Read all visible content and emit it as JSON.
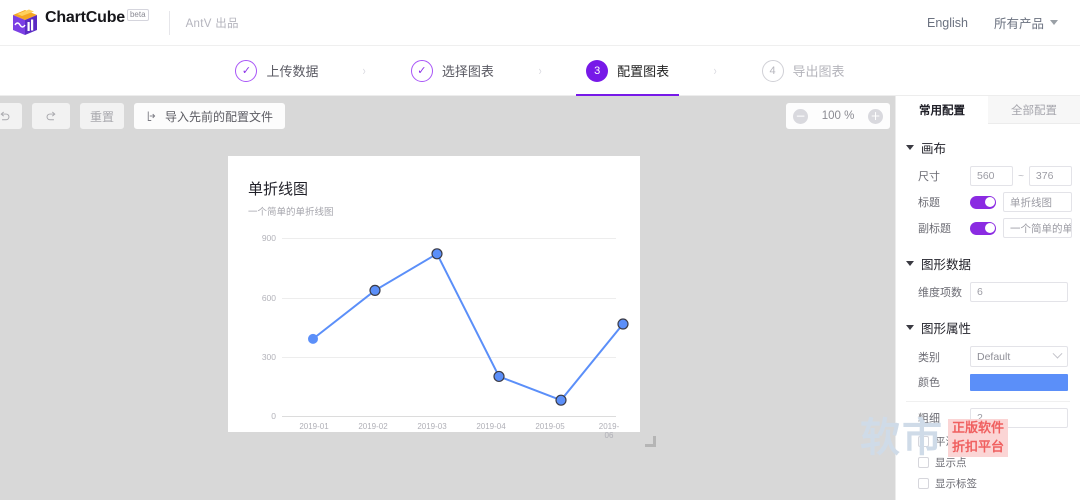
{
  "header": {
    "brand": "ChartCube",
    "badge": "beta",
    "antv": "AntV 出品",
    "language": "English",
    "products": "所有产品",
    "caret_icon": "chevron-down-icon"
  },
  "steps": [
    {
      "badge": "✓",
      "label": "上传数据",
      "state": "done"
    },
    {
      "badge": "✓",
      "label": "选择图表",
      "state": "done"
    },
    {
      "badge": "3",
      "label": "配置图表",
      "state": "active"
    },
    {
      "badge": "4",
      "label": "导出图表",
      "state": "todo"
    }
  ],
  "step_separator": "›",
  "toolbar": {
    "undo_icon": "undo-arrow-icon",
    "redo_icon": "redo-arrow-icon",
    "reset_label": "重置",
    "import_label": "导入先前的配置文件",
    "import_icon": "import-file-icon",
    "zoom_minus": "−",
    "zoom_value": "100 %",
    "zoom_plus": "+"
  },
  "canvas": {
    "title": "单折线图",
    "subtitle": "一个简单的单折线图"
  },
  "chart_data": {
    "type": "line",
    "title": "单折线图",
    "subtitle": "一个简单的单折线图",
    "categories": [
      "2019-01",
      "2019-02",
      "2019-03",
      "2019-04",
      "2019-05",
      "2019-06"
    ],
    "values": [
      390,
      635,
      820,
      200,
      80,
      465
    ],
    "series": [
      {
        "name": "单折线图",
        "values": [
          390,
          635,
          820,
          200,
          80,
          465
        ]
      }
    ],
    "xlabel": "",
    "ylabel": "",
    "ylim": [
      0,
      900
    ],
    "yticks": [
      0,
      300,
      600,
      900
    ],
    "grid": true,
    "legend": "none",
    "line_color": "#5b8ff9",
    "point_color": "#5b8ff9",
    "line_width": 2,
    "smooth": false,
    "show_points": true,
    "show_labels": false
  },
  "panel": {
    "tabs": [
      {
        "label": "常用配置",
        "active": true
      },
      {
        "label": "全部配置",
        "active": false
      }
    ],
    "sections": {
      "canvas": {
        "title": "画布",
        "size_label": "尺寸",
        "size_width": "560",
        "size_separator": "~",
        "size_height": "376",
        "title_label": "标题",
        "title_value": "单折线图",
        "title_enabled": true,
        "subtitle_label": "副标题",
        "subtitle_value": "一个简单的单折线",
        "subtitle_enabled": true
      },
      "data": {
        "title": "图形数据",
        "dimension_label": "维度项数",
        "dimension_value": "6"
      },
      "style": {
        "title": "图形属性",
        "category_label": "类别",
        "category_value": "Default",
        "color_label": "颜色",
        "color_value": "#5b8ff9",
        "thickness_label": "粗细",
        "thickness_value": "2",
        "checkboxes": [
          {
            "label": "平滑",
            "checked": false
          },
          {
            "label": "显示点",
            "checked": false
          },
          {
            "label": "显示标签",
            "checked": false
          }
        ]
      }
    }
  },
  "watermark": {
    "text_cn": "软市",
    "badge_line1": "正版软件",
    "badge_line2": "折扣平台"
  }
}
